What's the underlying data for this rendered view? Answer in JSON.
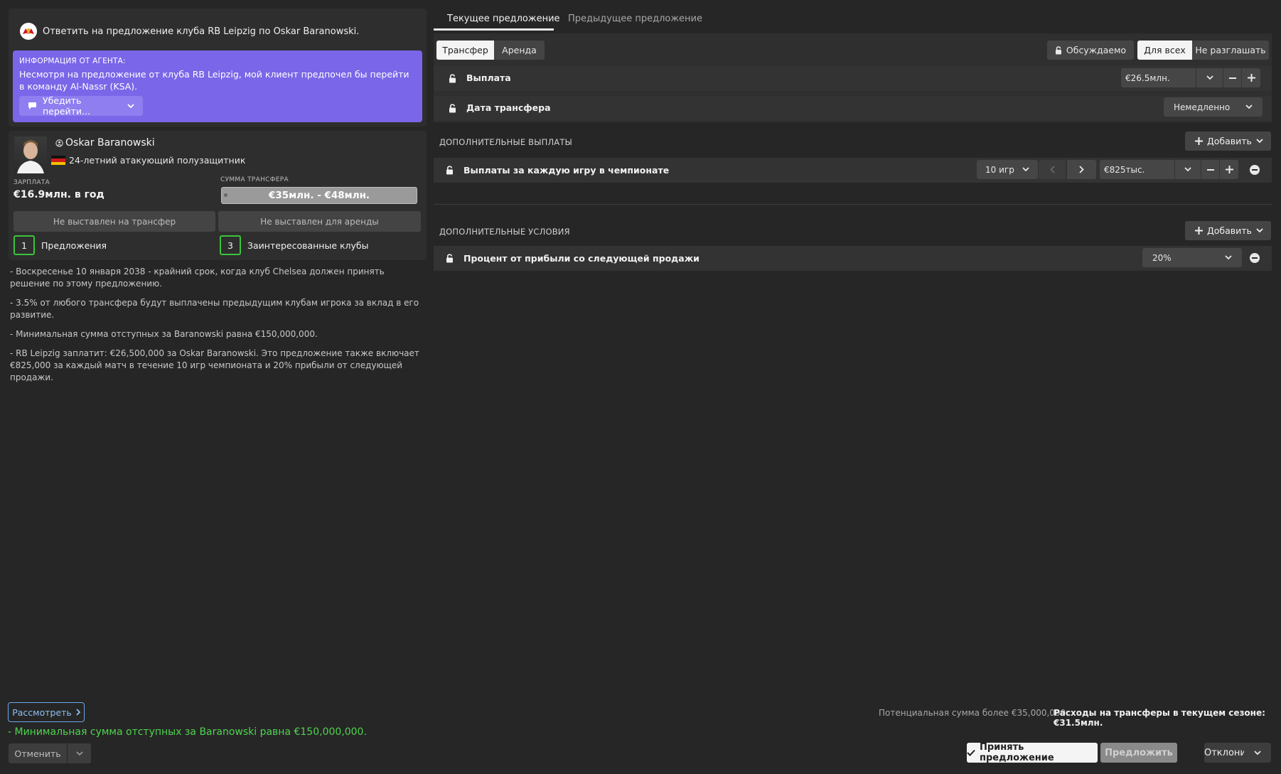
{
  "header": {
    "title": "Ответить на предложение клуба RB Leipzig по Oskar Baranowski.",
    "agent_label": "ИНФОРМАЦИЯ ОТ АГЕНТА:",
    "agent_text": "Несмотря на предложение от клуба RB Leipzig, мой клиент предпочел бы перейти в команду Al-Nassr (KSA).",
    "persuade_label": "Убедить перейти..."
  },
  "player": {
    "name": "Oskar Baranowski",
    "description": "24-летний атакующий полузащитник",
    "salary_label": "ЗАРПЛАТА",
    "salary": "€16.9млн. в год",
    "fee_label": "СУММА ТРАНСФЕРА",
    "fee": "€35млн. - €48млн.",
    "transfer_status": "Не выставлен на трансфер",
    "loan_status": "Не выставлен для аренды",
    "offers_count": "1",
    "offers_label": "Предложения",
    "clubs_count": "3",
    "clubs_label": "Заинтересованные клубы"
  },
  "notes": [
    "- Воскресенье 10 января 2038 - крайний срок, когда клуб Chelsea должен принять решение по этому предложению.",
    "- 3.5% от любого трансфера будут выплачены предыдущим клубам игрока за вклад в его развитие.",
    "- Минимальная сумма отступных за Baranowski равна €150,000,000.",
    "- RB Leipzig заплатит: €26,500,000 за Oskar Baranowski. Это предложение также включает €825,000 за каждый матч в течение 10 игр чемпионата и 20% прибыли от следующей продажи."
  ],
  "bottom_left": {
    "review_label": "Рассмотреть",
    "green_note": "- Минимальная сумма отступных за Baranowski равна €150,000,000.",
    "cancel_label": "Отменить"
  },
  "tabs": {
    "current": "Текущее предложение",
    "previous": "Предыдущее предложение"
  },
  "offer": {
    "type_transfer": "Трансфер",
    "type_loan": "Аренда",
    "negotiable": "Обсуждаемо",
    "public": "Для всех",
    "private": "Не разглашать",
    "payment_label": "Выплата",
    "payment_value": "€26.5млн.",
    "date_label": "Дата трансфера",
    "date_value": "Немедленно"
  },
  "extra_payments": {
    "section_label": "ДОПОЛНИТЕЛЬНЫЕ ВЫПЛАТЫ",
    "add_label": "Добавить",
    "item_label": "Выплаты за каждую игру в чемпионате",
    "games_value": "10 игр",
    "amount_value": "€825тыс."
  },
  "extra_conditions": {
    "section_label": "ДОПОЛНИТЕЛЬНЫЕ УСЛОВИЯ",
    "add_label": "Добавить",
    "item_label": "Процент от прибыли со следующей продажи",
    "percent_value": "20%"
  },
  "footer": {
    "potential": "Потенциальная сумма более €35,000,000",
    "expenses": "Расходы на трансферы в текущем сезоне: €31.5млн.",
    "accept_label": "Принять предложение",
    "propose_label": "Предложить",
    "reject_label": "Отклонить"
  },
  "colors": {
    "agent_bg": "#7a66e8",
    "count_border": "#3cc43c",
    "green_note": "#4fd34f",
    "review_border": "#6aa8e8"
  }
}
